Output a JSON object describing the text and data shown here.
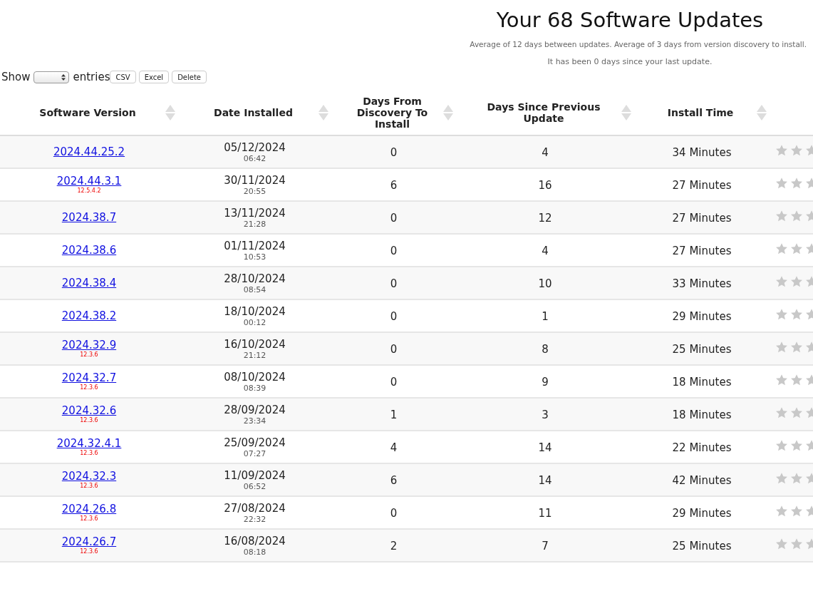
{
  "title": "Your 68 Software Updates",
  "stats": [
    "Average of 12 days between updates. Average of 3 days from version discovery to install.",
    "It has been 0 days since your last update."
  ],
  "controls": {
    "show_label": "Show",
    "entries_label": "entries",
    "buttons": [
      "CSV",
      "Excel",
      "Delete"
    ]
  },
  "table": {
    "columns": [
      "Software Version",
      "Date Installed",
      "Days From Discovery To Install",
      "Days Since Previous Update",
      "Install Time"
    ],
    "rows": [
      {
        "version": "2024.44.25.2",
        "sub_version": null,
        "date": "05/12/2024",
        "time": "06:42",
        "discovery_days": "0",
        "since_previous": "4",
        "install_time": "34 Minutes",
        "stars": 0
      },
      {
        "version": "2024.44.3.1",
        "sub_version": "12.5.4.2",
        "date": "30/11/2024",
        "time": "20:55",
        "discovery_days": "6",
        "since_previous": "16",
        "install_time": "27 Minutes",
        "stars": 0
      },
      {
        "version": "2024.38.7",
        "sub_version": null,
        "date": "13/11/2024",
        "time": "21:28",
        "discovery_days": "0",
        "since_previous": "12",
        "install_time": "27 Minutes",
        "stars": 0
      },
      {
        "version": "2024.38.6",
        "sub_version": null,
        "date": "01/11/2024",
        "time": "10:53",
        "discovery_days": "0",
        "since_previous": "4",
        "install_time": "27 Minutes",
        "stars": 0
      },
      {
        "version": "2024.38.4",
        "sub_version": null,
        "date": "28/10/2024",
        "time": "08:54",
        "discovery_days": "0",
        "since_previous": "10",
        "install_time": "33 Minutes",
        "stars": 0
      },
      {
        "version": "2024.38.2",
        "sub_version": null,
        "date": "18/10/2024",
        "time": "00:12",
        "discovery_days": "0",
        "since_previous": "1",
        "install_time": "29 Minutes",
        "stars": 0
      },
      {
        "version": "2024.32.9",
        "sub_version": "12.3.6",
        "date": "16/10/2024",
        "time": "21:12",
        "discovery_days": "0",
        "since_previous": "8",
        "install_time": "25 Minutes",
        "stars": 0
      },
      {
        "version": "2024.32.7",
        "sub_version": "12.3.6",
        "date": "08/10/2024",
        "time": "08:39",
        "discovery_days": "0",
        "since_previous": "9",
        "install_time": "18 Minutes",
        "stars": 0
      },
      {
        "version": "2024.32.6",
        "sub_version": "12.3.6",
        "date": "28/09/2024",
        "time": "23:34",
        "discovery_days": "1",
        "since_previous": "3",
        "install_time": "18 Minutes",
        "stars": 0
      },
      {
        "version": "2024.32.4.1",
        "sub_version": "12.3.6",
        "date": "25/09/2024",
        "time": "07:27",
        "discovery_days": "4",
        "since_previous": "14",
        "install_time": "22 Minutes",
        "stars": 0
      },
      {
        "version": "2024.32.3",
        "sub_version": "12.3.6",
        "date": "11/09/2024",
        "time": "06:52",
        "discovery_days": "6",
        "since_previous": "14",
        "install_time": "42 Minutes",
        "stars": 0
      },
      {
        "version": "2024.26.8",
        "sub_version": "12.3.6",
        "date": "27/08/2024",
        "time": "22:32",
        "discovery_days": "0",
        "since_previous": "11",
        "install_time": "29 Minutes",
        "stars": 0
      },
      {
        "version": "2024.26.7",
        "sub_version": "12.3.6",
        "date": "16/08/2024",
        "time": "08:18",
        "discovery_days": "2",
        "since_previous": "7",
        "install_time": "25 Minutes",
        "stars": 0
      }
    ]
  }
}
